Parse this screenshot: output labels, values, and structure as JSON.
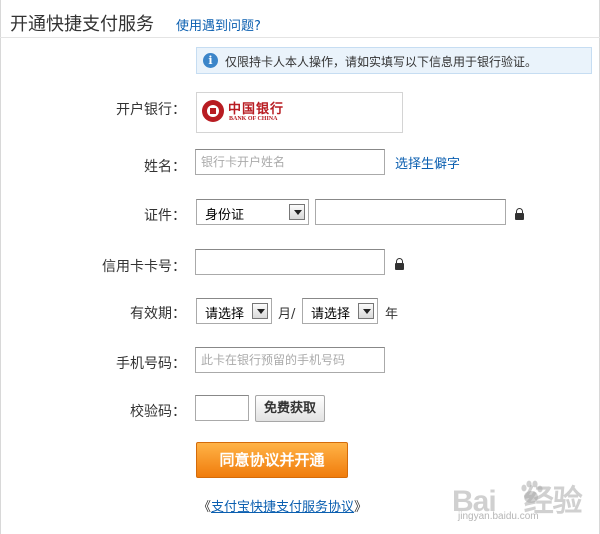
{
  "header": {
    "title": "开通快捷支付服务",
    "help_link": "使用遇到问题?"
  },
  "notice": {
    "icon": "info-icon",
    "icon_glyph": "i",
    "text": "仅限持卡人本人操作，请如实填写以下信息用于银行验证。"
  },
  "form": {
    "bank": {
      "label": "开户银行：",
      "logo_cn": "中国银行",
      "logo_en": "BANK OF CHINA"
    },
    "name": {
      "label": "姓名：",
      "placeholder": "银行卡开户姓名",
      "value": "",
      "rare_char_link": "选择生僻字"
    },
    "id": {
      "label": "证件：",
      "type_selected": "身份证",
      "value": ""
    },
    "card_number": {
      "label": "信用卡卡号：",
      "value": ""
    },
    "expiry": {
      "label": "有效期：",
      "month_selected": "请选择",
      "month_unit": "月/",
      "year_selected": "请选择",
      "year_unit": "年"
    },
    "phone": {
      "label": "手机号码：",
      "placeholder": "此卡在银行预留的手机号码",
      "value": ""
    },
    "verify_code": {
      "label": "校验码：",
      "value": "",
      "get_button": "免费获取"
    }
  },
  "submit": {
    "label": "同意协议并开通"
  },
  "agreement": {
    "open_quote": "《",
    "link": "支付宝快捷支付服务协议",
    "close_quote": "》"
  },
  "watermark": {
    "main_left": "Bai",
    "main_right": "经验",
    "sub": "jingyan.baidu.com"
  },
  "colors": {
    "link": "#0b5fb0",
    "submit_bg": "#f07c0c",
    "notice_bg": "#eaf3fb",
    "boc_red": "#b81c22"
  }
}
